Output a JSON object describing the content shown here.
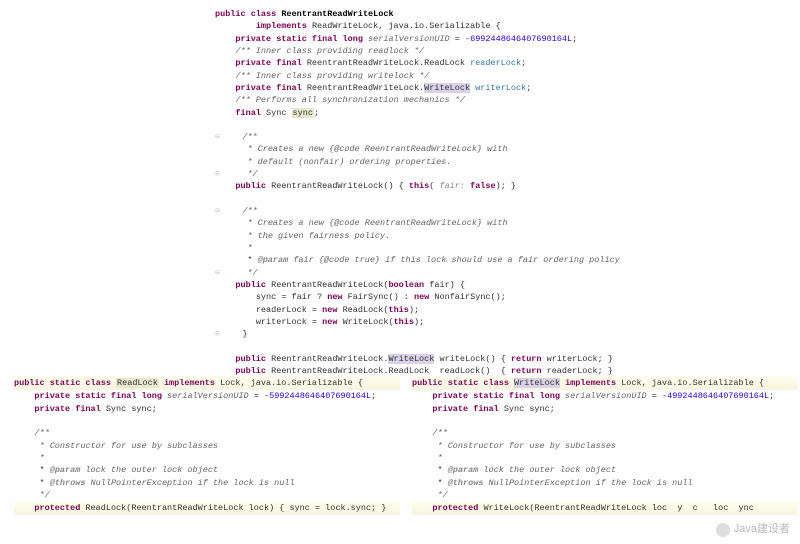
{
  "main": {
    "l1a": "public class",
    "l1b": "ReentrantReadWriteLock",
    "l2a": "implements",
    "l2b": "ReadWriteLock, java.io.Serializable {",
    "l3a": "private static final long",
    "l3b": "serialVersionUID",
    "l3c": "= -",
    "l3d": "6992448646407690164L",
    "l3e": ";",
    "l4": "/** Inner class providing readlock */",
    "l5a": "private final",
    "l5b": "ReentrantReadWriteLock.ReadLock",
    "l5c": "readerLock",
    "l5d": ";",
    "l6": "/** Inner class providing writelock */",
    "l7a": "private final",
    "l7b": "ReentrantReadWriteLock.",
    "l7c": "WriteLock",
    "l7d": "writerLock",
    "l7e": ";",
    "l8": "/** Performs all synchronization mechanics */",
    "l9a": "final",
    "l9b": "Sync",
    "l9c": "sync",
    "l9d": ";",
    "jd1a": "/**",
    "jd1b": " * Creates a new {@code ReentrantReadWriteLock} with",
    "jd1c": " * default (nonfair) ordering properties.",
    "jd1d": " */",
    "c1a": "public",
    "c1b": "ReentrantReadWriteLock",
    "c1c": "() {",
    "c1d": "this",
    "c1e": "(",
    "c1f": "fair:",
    "c1g": "false",
    "c1h": "); }",
    "jd2a": "/**",
    "jd2b": " * Creates a new {@code ReentrantReadWriteLock} with",
    "jd2c": " * the given fairness policy.",
    "jd2d": " *",
    "jd2e_tag": "@param",
    "jd2e_rest": " fair {@code true} if this lock should use a fair ordering policy",
    "jd2f": " */",
    "c2a": "public",
    "c2b": "ReentrantReadWriteLock",
    "c2c": "(",
    "c2d": "boolean",
    "c2e": "fair) {",
    "c2f": "sync = fair ?",
    "c2g": "new",
    "c2h": "FairSync() :",
    "c2i": "new",
    "c2j": "NonfairSync();",
    "c2k": "readerLock =",
    "c2l": "new",
    "c2m": "ReadLock(",
    "c2n": "this",
    "c2o": ");",
    "c2p": "writerLock =",
    "c2q": "new",
    "c2r": "WriteLock(",
    "c2s": "this",
    "c2t": ");",
    "c2u": "}",
    "m1a": "public",
    "m1b": "ReentrantReadWriteLock.",
    "m1c": "WriteLock",
    "m1d": "writeLock() {",
    "m1e": "return",
    "m1f": "writerLock; }",
    "m2a": "public",
    "m2b": "ReentrantReadWriteLock.ReadLock  readLock()  {",
    "m2c": "return",
    "m2d": "readerLock; }"
  },
  "left": {
    "d1a": "public static class",
    "d1b": "ReadLock",
    "d1c": "implements",
    "d1d": "Lock, java.io.Serializable {",
    "s1a": "private static final long",
    "s1b": "serialVersionUID",
    "s1c": "= -",
    "s1d": "5992448646407690164L",
    "s1e": ";",
    "s2a": "private final",
    "s2b": "Sync sync;",
    "jd_a": "/**",
    "jd_b": " * Constructor for use by subclasses",
    "jd_c": " *",
    "jd_d_tag": "@param",
    "jd_d_rest": " lock the outer lock object",
    "jd_e_tag": "@throws",
    "jd_e_rest": " NullPointerException if the lock is null",
    "jd_f": " */",
    "c_a": "protected",
    "c_b": "ReadLock(ReentrantReadWriteLock lock) { sync = lock.sync; }"
  },
  "right": {
    "d1a": "public static class",
    "d1b": "WriteLock",
    "d1c": "implements",
    "d1d": "Lock, java.io.Serializable {",
    "s1a": "private static final long",
    "s1b": "serialVersionUID",
    "s1c": "= -",
    "s1d": "4992448646407690164L",
    "s1e": ";",
    "s2a": "private final",
    "s2b": "Sync sync;",
    "jd_a": "/**",
    "jd_b": " * Constructor for use by subclasses",
    "jd_c": " *",
    "jd_d_tag": "@param",
    "jd_d_rest": " lock the outer lock object",
    "jd_e_tag": "@throws",
    "jd_e_rest": " NullPointerException if the lock is null",
    "jd_f": " */",
    "c_a": "protected",
    "c_b": "WriteLock(ReentrantReadWriteLock loc",
    "c_c": "y",
    "c_d": "c",
    "c_e": "loc",
    "c_f": "ync"
  },
  "watermark": "Java建设者"
}
